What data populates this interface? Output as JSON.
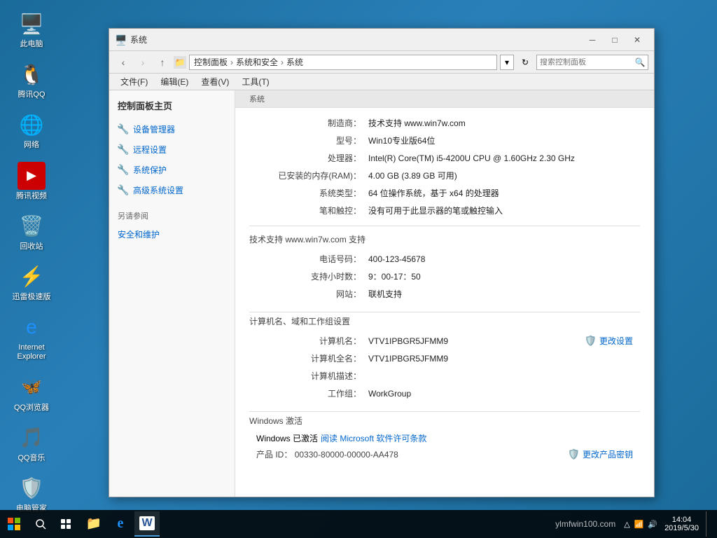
{
  "desktop": {
    "icons": [
      {
        "id": "computer",
        "label": "此电脑",
        "icon": "🖥️"
      },
      {
        "id": "qq",
        "label": "腾讯QQ",
        "icon": "🐧"
      },
      {
        "id": "network",
        "label": "网络",
        "icon": "🌐"
      },
      {
        "id": "tencent-video",
        "label": "腾讯视频",
        "icon": "▶️"
      },
      {
        "id": "recycle",
        "label": "回收站",
        "icon": "🗑️"
      },
      {
        "id": "xunlei",
        "label": "迅雷极速版",
        "icon": "⚡"
      },
      {
        "id": "ie",
        "label": "Internet Explorer",
        "icon": "🌀"
      },
      {
        "id": "qq-browser",
        "label": "QQ浏览器",
        "icon": "🐟"
      },
      {
        "id": "qq-music",
        "label": "QQ音乐",
        "icon": "🎵"
      },
      {
        "id": "pc-manager",
        "label": "电脑管家",
        "icon": "🛡️"
      }
    ]
  },
  "window": {
    "title": "系统",
    "title_icon": "🖥️",
    "address": {
      "back_disabled": false,
      "forward_disabled": true,
      "path_parts": [
        "控制面板",
        "系统和安全",
        "系统"
      ],
      "search_placeholder": "搜索控制面板"
    },
    "menu": {
      "items": [
        "文件(F)",
        "编辑(E)",
        "查看(V)",
        "工具(T)"
      ]
    },
    "sidebar": {
      "main_title": "控制面板主页",
      "links": [
        {
          "id": "device-manager",
          "label": "设备管理器"
        },
        {
          "id": "remote-settings",
          "label": "远程设置"
        },
        {
          "id": "system-protection",
          "label": "系统保护"
        },
        {
          "id": "advanced-settings",
          "label": "高级系统设置"
        }
      ],
      "also_see": {
        "title": "另请参阅",
        "items": [
          "安全和维护"
        ]
      }
    },
    "content": {
      "section_header": "系统",
      "manufacturer_label": "制造商：",
      "manufacturer_value": "技术支持 www.win7w.com",
      "model_label": "型号：",
      "model_value": "Win10专业版64位",
      "processor_label": "处理器：",
      "processor_value": "Intel(R) Core(TM) i5-4200U CPU @ 1.60GHz   2.30 GHz",
      "ram_label": "已安装的内存(RAM)：",
      "ram_value": "4.00 GB (3.89 GB 可用)",
      "os_type_label": "系统类型：",
      "os_type_value": "64 位操作系统，基于 x64 的处理器",
      "pen_label": "笔和触控：",
      "pen_value": "没有可用于此显示器的笔或触控输入",
      "support_section": "技术支持 www.win7w.com 支持",
      "phone_label": "电话号码：",
      "phone_value": "400-123-45678",
      "hours_label": "支持小时数：",
      "hours_value": "9：00-17：50",
      "website_label": "网站：",
      "website_value": "联机支持",
      "computer_section": "计算机名、域和工作组设置",
      "computer_name_label": "计算机名：",
      "computer_name_value": "VTV1IPBGR5JFMM9",
      "computer_fullname_label": "计算机全名：",
      "computer_fullname_value": "VTV1IPBGR5JFMM9",
      "computer_desc_label": "计算机描述：",
      "computer_desc_value": "",
      "workgroup_label": "工作组：",
      "workgroup_value": "WorkGroup",
      "change_settings_label": "更改设置",
      "activation_section": "Windows 激活",
      "activation_status": "Windows 已激活",
      "activation_link": "阅读 Microsoft 软件许可条款",
      "product_id_label": "产品 ID：",
      "product_id_value": "00330-80000-00000-AA478",
      "change_key_label": "更改产品密钥"
    }
  },
  "taskbar": {
    "apps": [
      {
        "id": "start",
        "icon": "⊞"
      },
      {
        "id": "search",
        "icon": "🔍"
      },
      {
        "id": "task-view",
        "icon": "⧉"
      },
      {
        "id": "file-explorer",
        "icon": "📁",
        "active": true
      },
      {
        "id": "ie",
        "icon": "🌀"
      },
      {
        "id": "word",
        "icon": "W"
      }
    ],
    "tray": {
      "icons": [
        "△",
        "🔊",
        "📶"
      ],
      "time": "14:04",
      "date": "2019/5/30"
    },
    "watermark": "ylmfwin100.com"
  }
}
